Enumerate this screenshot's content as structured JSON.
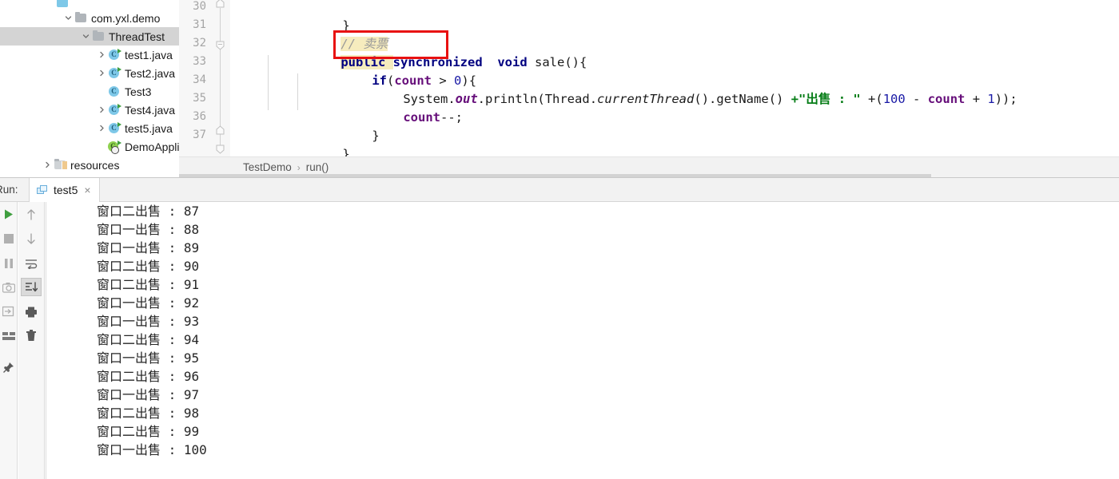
{
  "project_tree": {
    "items": [
      {
        "label": "",
        "indent": 70,
        "arrow": "none",
        "icon": "folder-partial",
        "selected": false,
        "partial": true
      },
      {
        "label": "com.yxl.demo",
        "indent": 78,
        "arrow": "down",
        "icon": "package-folder",
        "selected": false
      },
      {
        "label": "ThreadTest",
        "indent": 100,
        "arrow": "down",
        "icon": "package-folder",
        "selected": true
      },
      {
        "label": "test1.java",
        "indent": 120,
        "arrow": "right",
        "icon": "java-class",
        "selected": false
      },
      {
        "label": "Test2.java",
        "indent": 120,
        "arrow": "right",
        "icon": "java-class",
        "selected": false
      },
      {
        "label": "Test3",
        "indent": 120,
        "arrow": "none",
        "icon": "java-class",
        "selected": false
      },
      {
        "label": "Test4.java",
        "indent": 120,
        "arrow": "right",
        "icon": "java-class",
        "selected": false
      },
      {
        "label": "test5.java",
        "indent": 120,
        "arrow": "right",
        "icon": "java-class",
        "selected": false
      },
      {
        "label": "DemoApplication",
        "indent": 120,
        "arrow": "none",
        "icon": "spring-boot-class",
        "selected": false
      },
      {
        "label": "resources",
        "indent": 52,
        "arrow": "right",
        "icon": "resources-folder",
        "selected": false
      }
    ]
  },
  "editor": {
    "line_numbers": [
      "30",
      "31",
      "32",
      "33",
      "34",
      "35",
      "36",
      "37"
    ],
    "lines": [
      {
        "n": "30",
        "text": "}"
      },
      {
        "n": "31",
        "text": "// 卖票"
      },
      {
        "n": "32",
        "text": "public synchronized  void sale(){"
      },
      {
        "n": "33",
        "text": "if(count > 0){"
      },
      {
        "n": "34",
        "text": "System.out.println(Thread.currentThread().getName() +\"出售 : \" +(100 - count + 1));"
      },
      {
        "n": "35",
        "text": "count--;"
      },
      {
        "n": "36",
        "text": "}"
      },
      {
        "n": "37",
        "text": "}"
      }
    ],
    "tokens": {
      "comment": "// 卖票",
      "kw_public": "public",
      "kw_synchronized": "synchronized",
      "kw_void": "void",
      "method_name": "sale",
      "kw_if": "if",
      "field_count": "count",
      "op_gt": ">",
      "num_zero": "0",
      "system": "System",
      "out": "out",
      "println": "println",
      "thread": "Thread",
      "current_thread": "currentThread",
      "get_name": "getName",
      "string_literal": "\"出售 : \"",
      "num_hundred": "100",
      "num_one": "1",
      "decrement": "count--;",
      "brace_open": "{",
      "brace_close": "}"
    },
    "annotation": {
      "type": "red-rectangle",
      "target": "synchronized",
      "color": "#e81111"
    }
  },
  "breadcrumb": {
    "items": [
      "TestDemo",
      "run()"
    ],
    "separator": "›"
  },
  "run_panel": {
    "label": "Run:",
    "tab": {
      "name": "test5",
      "close": "×"
    },
    "toolbar_a": [
      {
        "name": "rerun-button",
        "icon": "play-green"
      },
      {
        "name": "stop-button",
        "icon": "stop-square"
      },
      {
        "name": "pause-button",
        "icon": "pause-bars"
      },
      {
        "name": "screenshot-button",
        "icon": "camera"
      },
      {
        "name": "export-button",
        "icon": "export-arrow"
      },
      {
        "name": "layout-button",
        "icon": "layout-blocks"
      },
      {
        "name": "pin-button",
        "icon": "pin"
      }
    ],
    "toolbar_b": [
      {
        "name": "up-button",
        "icon": "arrow-up"
      },
      {
        "name": "down-button",
        "icon": "arrow-down"
      },
      {
        "name": "soft-wrap-button",
        "icon": "soft-wrap"
      },
      {
        "name": "scroll-to-end-button",
        "icon": "scroll-end",
        "active": true
      },
      {
        "name": "print-button",
        "icon": "printer"
      },
      {
        "name": "clear-button",
        "icon": "trash"
      }
    ],
    "console_lines": [
      "窗口二出售 : 87",
      "窗口一出售 : 88",
      "窗口一出售 : 89",
      "窗口二出售 : 90",
      "窗口二出售 : 91",
      "窗口一出售 : 92",
      "窗口一出售 : 93",
      "窗口二出售 : 94",
      "窗口一出售 : 95",
      "窗口二出售 : 96",
      "窗口一出售 : 97",
      "窗口二出售 : 98",
      "窗口二出售 : 99",
      "窗口一出售 : 100"
    ]
  },
  "colors": {
    "keyword": "#000080",
    "string": "#067d17",
    "number": "#1a1aa6",
    "field": "#660e7a",
    "comment": "#9a9a9a",
    "highlight": "#f6ecbe",
    "annotation": "#e81111",
    "selection": "#d4d4d4"
  }
}
